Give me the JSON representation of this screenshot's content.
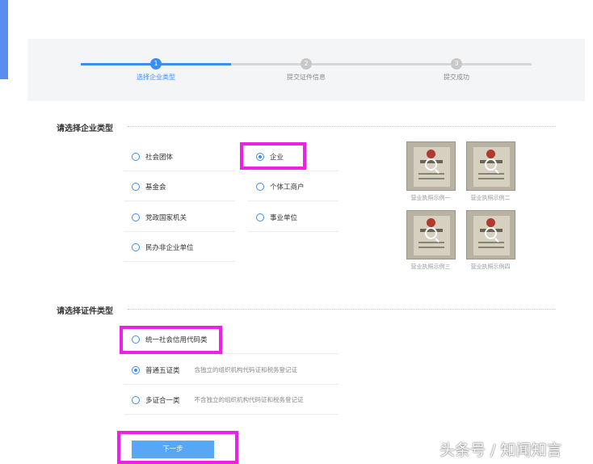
{
  "steps": [
    {
      "number": "1",
      "label": "选择企业类型",
      "active": true
    },
    {
      "number": "2",
      "label": "提交证件信息",
      "active": false
    },
    {
      "number": "3",
      "label": "提交成功",
      "active": false
    }
  ],
  "enterprise_section": {
    "title": "请选择企业类型",
    "options": [
      "社会团体",
      "企业",
      "基金会",
      "个体工商户",
      "党政国家机关",
      "事业单位",
      "民办非企业单位"
    ],
    "selected": "企业"
  },
  "license_examples": [
    "营业执照示例一",
    "营业执照示例二",
    "营业执照示例三",
    "营业执照示例四"
  ],
  "certificate_section": {
    "title": "请选择证件类型",
    "options": [
      {
        "label": "统一社会信用代码类",
        "desc": ""
      },
      {
        "label": "普通五证类",
        "desc": "含独立的组织机构代码证和税务登记证"
      },
      {
        "label": "多证合一类",
        "desc": "不含独立的组织机构代码证和税务登记证"
      }
    ],
    "selected": "普通五证类"
  },
  "next_button": "下一步",
  "watermark": "头条号 / 知闻知言",
  "colors": {
    "accent": "#3b8ef0",
    "highlight": "#ee1fe6",
    "button": "#57a7f5"
  }
}
